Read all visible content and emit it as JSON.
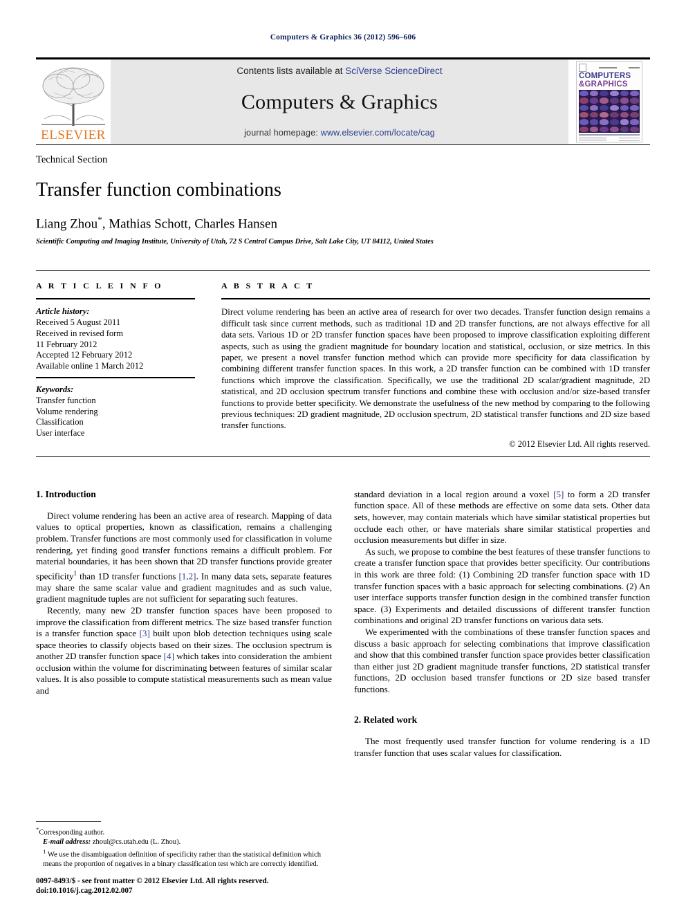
{
  "running_head": "Computers & Graphics 36 (2012) 596–606",
  "masthead": {
    "elsevier_wordmark": "ELSEVIER",
    "contents_prefix": "Contents lists available at",
    "contents_link": "SciVerse ScienceDirect",
    "journal_name": "Computers & Graphics",
    "homepage_prefix": "journal homepage:",
    "homepage_url": "www.elsevier.com/locate/cag",
    "cover_title_line1": "COMPUTERS",
    "cover_title_line2": "&GRAPHICS"
  },
  "title_block": {
    "section_type": "Technical Section",
    "title": "Transfer function combinations",
    "authors": "Liang Zhou",
    "corresponding_mark": "*",
    "authors_rest": ", Mathias Schott, Charles Hansen",
    "affiliation": "Scientific Computing and Imaging Institute, University of Utah, 72 S Central Campus Drive, Salt Lake City, UT 84112, United States"
  },
  "article_info": {
    "label": "A R T I C L E   I N F O",
    "history_heading": "Article history:",
    "history_lines": [
      "Received 5 August 2011",
      "Received in revised form",
      "11 February 2012",
      "Accepted 12 February 2012",
      "Available online 1 March 2012"
    ],
    "keywords_heading": "Keywords:",
    "keywords": [
      "Transfer function",
      "Volume rendering",
      "Classification",
      "User interface"
    ]
  },
  "abstract": {
    "label": "A B S T R A C T",
    "text": "Direct volume rendering has been an active area of research for over two decades. Transfer function design remains a difficult task since current methods, such as traditional 1D and 2D transfer functions, are not always effective for all data sets. Various 1D or 2D transfer function spaces have been proposed to improve classification exploiting different aspects, such as using the gradient magnitude for boundary location and statistical, occlusion, or size metrics. In this paper, we present a novel transfer function method which can provide more specificity for data classification by combining different transfer function spaces. In this work, a 2D transfer function can be combined with 1D transfer functions which improve the classification. Specifically, we use the traditional 2D scalar/gradient magnitude, 2D statistical, and 2D occlusion spectrum transfer functions and combine these with occlusion and/or size-based transfer functions to provide better specificity. We demonstrate the usefulness of the new method by comparing to the following previous techniques: 2D gradient magnitude, 2D occlusion spectrum, 2D statistical transfer functions and 2D size based transfer functions.",
    "copyright": "© 2012 Elsevier Ltd. All rights reserved."
  },
  "body": {
    "section1_heading": "1.  Introduction",
    "section2_heading": "2.  Related work",
    "left_p1_a": "Direct volume rendering has been an active area of research. Mapping of data values to optical properties, known as classification, remains a challenging problem. Transfer functions are most commonly used for classification in volume rendering, yet finding good transfer functions remains a difficult problem. For material boundaries, it has been shown that 2D transfer functions provide greater specificity",
    "left_p1_b": " than 1D transfer functions ",
    "left_p1_ref": "[1,2]",
    "left_p1_c": ". In many data sets, separate features may share the same scalar value and gradient magnitudes and as such value, gradient magnitude tuples are not sufficient for separating such features.",
    "left_p2_a": "Recently, many new 2D transfer function spaces have been proposed to improve the classification from different metrics. The size based transfer function is a transfer function space ",
    "left_p2_ref1": "[3]",
    "left_p2_b": " built upon blob detection techniques using scale space theories to classify objects based on their sizes. The occlusion spectrum is another 2D transfer function space ",
    "left_p2_ref2": "[4]",
    "left_p2_c": " which takes into consideration the ambient occlusion within the volume for discriminating between features of similar scalar values. It is also possible to compute statistical measurements such as mean value and",
    "right_p1_a": "standard deviation in a local region around a voxel ",
    "right_p1_ref": "[5]",
    "right_p1_b": " to form a 2D transfer function space. All of these methods are effective on some data sets. Other data sets, however, may contain materials which have similar statistical properties but occlude each other, or have materials share similar statistical properties and occlusion measurements but differ in size.",
    "right_p2": "As such, we propose to combine the best features of these transfer functions to create a transfer function space that provides better specificity. Our contributions in this work are three fold: (1) Combining 2D transfer function space with 1D transfer function spaces with a basic approach for selecting combinations. (2) An user interface supports transfer function design in the combined transfer function space. (3) Experiments and detailed discussions of different transfer function combinations and original 2D transfer functions on various data sets.",
    "right_p3": "We experimented with the combinations of these transfer function spaces and discuss a basic approach for selecting combinations that improve classification and show that this combined transfer function space provides better classification than either just 2D gradient magnitude transfer functions, 2D statistical transfer functions, 2D occlusion based transfer functions or 2D size based transfer functions.",
    "right_p4": "The most frequently used transfer function for volume rendering is a 1D transfer function that uses scalar values for classification."
  },
  "footnotes": {
    "corresponding": "Corresponding author.",
    "email_label": "E-mail address:",
    "email_value": "zhoul@cs.utah.edu (L. Zhou).",
    "fn1_mark": "1",
    "fn1_text": "We use the disambiguation definition of specificity rather than the statistical definition which means the proportion of negatives in a binary classification test which are correctly identified.",
    "issn_line": "0097-8493/$ - see front matter © 2012 Elsevier Ltd. All rights reserved.",
    "doi_line": "doi:10.1016/j.cag.2012.02.007"
  },
  "colors": {
    "link": "#2b3c8f",
    "elsevier_orange": "#E87722",
    "running_head": "#11225c"
  }
}
